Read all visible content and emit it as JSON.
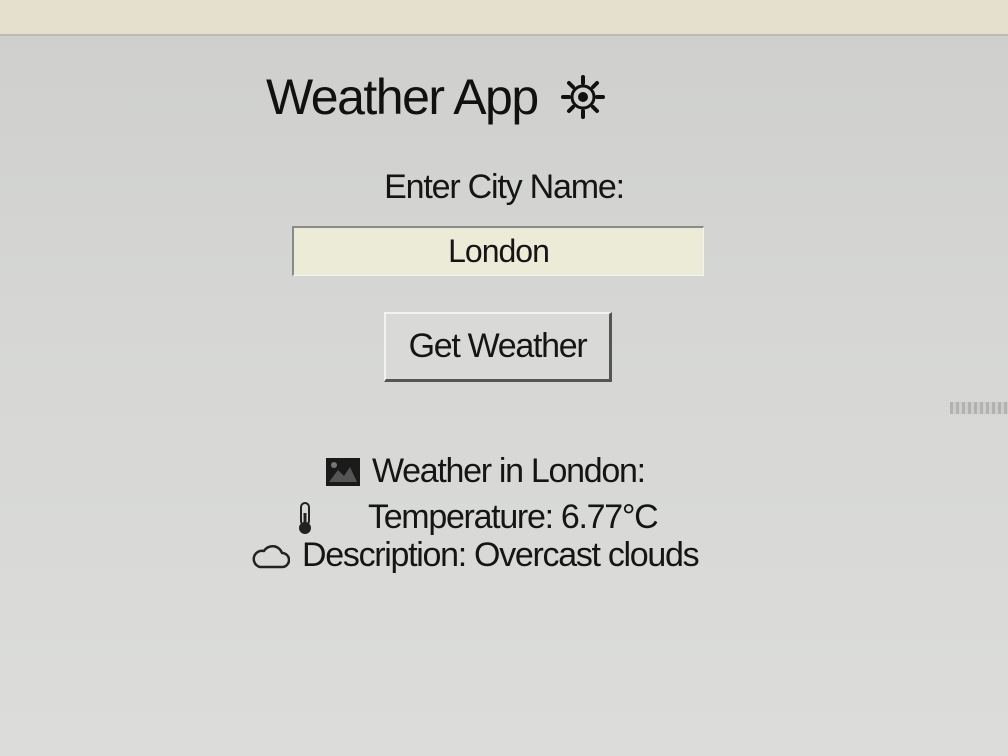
{
  "app": {
    "title": "Weather App",
    "title_icon": "gear-sun-icon"
  },
  "form": {
    "city_label": "Enter City Name:",
    "city_value": "London",
    "button_label": "Get Weather"
  },
  "result": {
    "heading": "Weather in London:",
    "heading_icon": "map-icon",
    "temperature": "Temperature: 6.77°C",
    "temperature_icon": "thermometer-icon",
    "description": "Description: Overcast clouds",
    "description_icon": "cloud-icon"
  },
  "colors": {
    "background": "#d9dad8",
    "input_background": "#ecebd8",
    "text": "#151515"
  }
}
